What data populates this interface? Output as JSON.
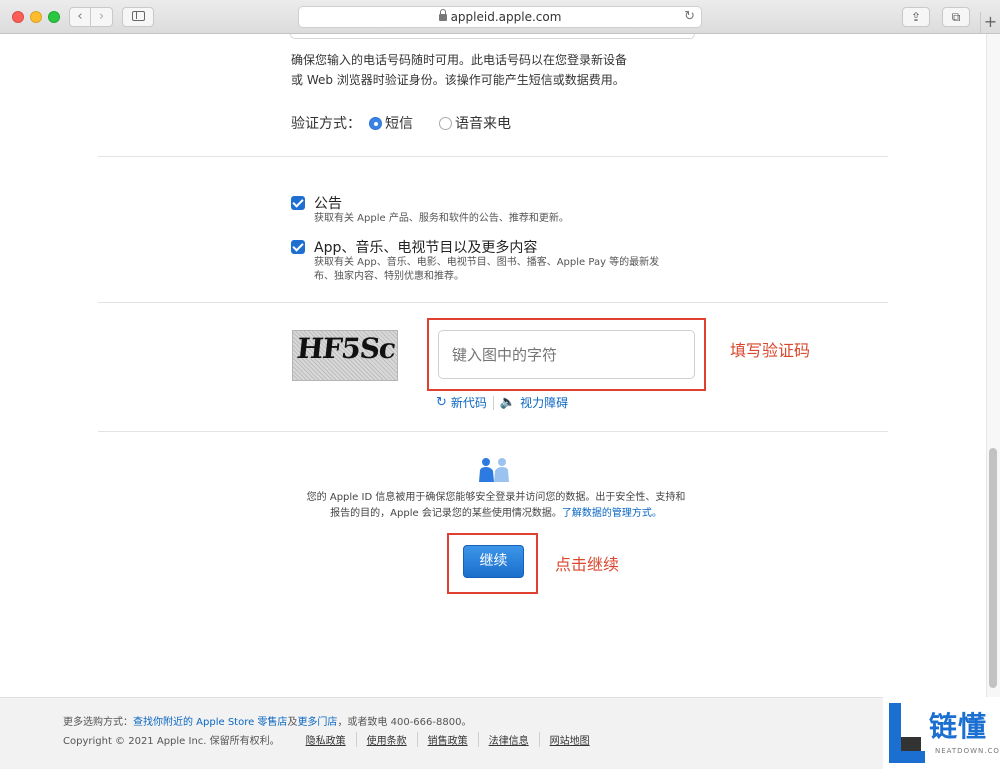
{
  "browser": {
    "url": "appleid.apple.com",
    "back": "‹",
    "forward": "›",
    "reload": "↻",
    "share": "⇪",
    "tabs": "⧉",
    "new_tab": "+"
  },
  "phone_note": {
    "line1": "确保您输入的电话号码随时可用。此电话号码以在您登录新设备",
    "line2": "或 Web 浏览器时验证身份。该操作可能产生短信或数据费用。"
  },
  "verify": {
    "label": "验证方式：",
    "options": [
      "短信",
      "语音来电"
    ],
    "selected": "短信"
  },
  "subscriptions": [
    {
      "title": "公告",
      "desc": "获取有关 Apple 产品、服务和软件的公告、推荐和更新。",
      "checked": true
    },
    {
      "title": "App、音乐、电视节目以及更多内容",
      "desc_line1": "获取有关 App、音乐、电影、电视节目、图书、播客、Apple Pay 等的最新发",
      "desc_line2": "布、独家内容、特别优惠和推荐。",
      "checked": true
    }
  ],
  "captcha": {
    "image_text": "HF5Sc",
    "placeholder": "键入图中的字符",
    "new_code": "新代码",
    "vision": "视力障碍",
    "annotation": "填写验证码"
  },
  "privacy": {
    "line1": "您的 Apple ID 信息被用于确保您能够安全登录并访问您的数据。出于安全性、支持和",
    "line2": "报告的目的，Apple 会记录您的某些使用情况数据。",
    "link": "了解数据的管理方式。"
  },
  "continue": {
    "label": "继续",
    "annotation": "点击继续"
  },
  "footer": {
    "more_ways": "更多选购方式：",
    "find_store": "查找你附近的 Apple Store 零售店",
    "and": "及",
    "more_stores": "更多门店",
    "or_call": "，或者致电 400-666-8800。",
    "copyright": "Copyright © 2021 Apple Inc. 保留所有权利。",
    "links": [
      "隐私政策",
      "使用条款",
      "销售政策",
      "法律信息",
      "网站地图"
    ]
  },
  "watermark": {
    "text": "链懂",
    "sub": "NEATDOWN.COM"
  },
  "colors": {
    "accent": "#1f6fd1",
    "annotation": "#e0402f",
    "button": "#1a6ecd"
  }
}
